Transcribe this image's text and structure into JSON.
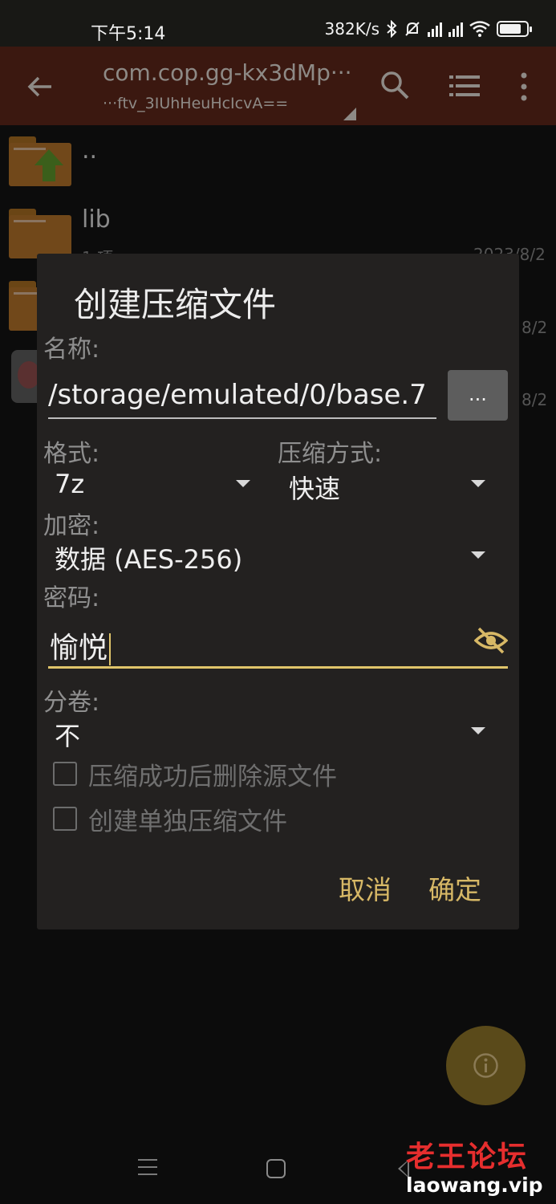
{
  "status_bar": {
    "time": "下午5:14",
    "net_speed": "382K/s",
    "icons": [
      "bluetooth-icon",
      "mute-icon",
      "signal-hd-icon",
      "signal-hd-icon",
      "wifi-icon",
      "battery-icon"
    ]
  },
  "toolbar": {
    "title": "com.cop.gg-kx3dMp···",
    "subtitle": "···ftv_3IUhHeuHcIcvA==",
    "icons": [
      "back-arrow-icon",
      "search-icon",
      "list-view-icon",
      "more-vert-icon"
    ]
  },
  "files": [
    {
      "name": "..",
      "meta": "",
      "date": "",
      "icon": "folder-up-icon"
    },
    {
      "name": "lib",
      "meta": "1 项",
      "date": "2023/8/2",
      "icon": "folder-icon"
    },
    {
      "name": "",
      "meta": "",
      "date": "8/2",
      "icon": "folder-icon"
    },
    {
      "name": "",
      "meta": "",
      "date": "8/2",
      "icon": "apk-icon"
    }
  ],
  "dialog": {
    "title": "创建压缩文件",
    "name_label": "名称:",
    "name_value": "/storage/emulated/0/base.7",
    "browse_label": "...",
    "format_label": "格式:",
    "format_value": "7z",
    "method_label": "压缩方式:",
    "method_value": "快速",
    "encrypt_label": "加密:",
    "encrypt_value": "数据 (AES-256)",
    "password_label": "密码:",
    "password_value": "愉悦",
    "split_label": "分卷:",
    "split_value": "不",
    "delete_source_label": "压缩成功后删除源文件",
    "delete_source_checked": false,
    "separate_archive_label": "创建单独压缩文件",
    "separate_archive_checked": false,
    "cancel_label": "取消",
    "ok_label": "确定"
  },
  "accent_color": "#e0c56a",
  "watermark": {
    "title": "老王论坛",
    "url": "laowang.vip"
  }
}
